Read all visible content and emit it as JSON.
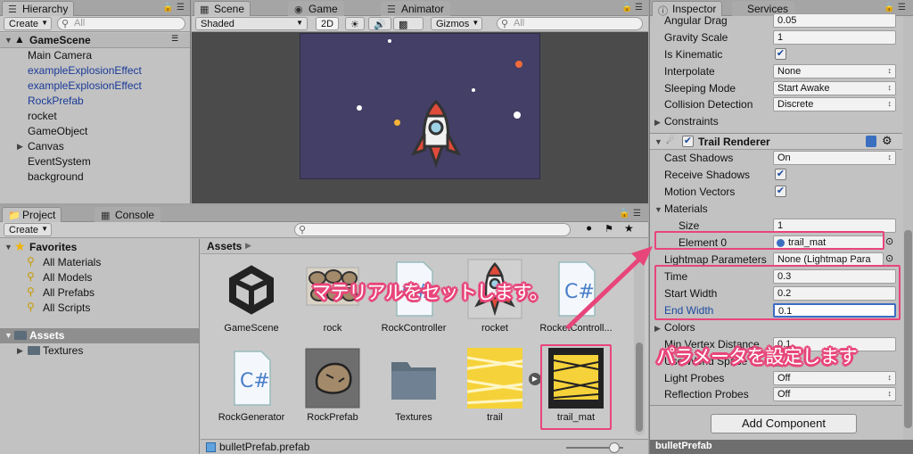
{
  "hierarchy": {
    "tab": "Hierarchy",
    "create_label": "Create",
    "search_placeholder": "All",
    "scene_name": "GameScene",
    "items": [
      {
        "label": "Main Camera",
        "prefab": false
      },
      {
        "label": "exampleExplosionEffect",
        "prefab": true
      },
      {
        "label": "exampleExplosionEffect",
        "prefab": true
      },
      {
        "label": "RockPrefab",
        "prefab": true
      },
      {
        "label": "rocket",
        "prefab": false
      },
      {
        "label": "GameObject",
        "prefab": false
      },
      {
        "label": "Canvas",
        "prefab": false
      },
      {
        "label": "EventSystem",
        "prefab": false
      },
      {
        "label": "background",
        "prefab": false
      }
    ]
  },
  "scene": {
    "tabs": [
      "Scene",
      "Game",
      "Animator"
    ],
    "shading_mode": "Shaded",
    "mode_2d": "2D",
    "gizmos_label": "Gizmos",
    "search_placeholder": "All",
    "background_color": "#433f66"
  },
  "project": {
    "tabs": [
      "Project",
      "Console"
    ],
    "create_label": "Create",
    "favorites_label": "Favorites",
    "favorites": [
      "All Materials",
      "All Models",
      "All Prefabs",
      "All Scripts"
    ],
    "assets_root": "Assets",
    "subfolders": [
      "Textures"
    ],
    "breadcrumb": "Assets",
    "assets_row1": [
      "GameScene",
      "rock",
      "RockController",
      "rocket",
      "RocketControll..."
    ],
    "assets_row2": [
      "RockGenerator",
      "RockPrefab",
      "Textures",
      "trail",
      "trail_mat"
    ],
    "selected_file": "bulletPrefab.prefab"
  },
  "inspector": {
    "tabs": [
      "Inspector",
      "Services"
    ],
    "rows": {
      "angular_drag": {
        "label": "Angular Drag",
        "value": "0.05"
      },
      "gravity_scale": {
        "label": "Gravity Scale",
        "value": "1"
      },
      "is_kinematic": {
        "label": "Is Kinematic"
      },
      "interpolate": {
        "label": "Interpolate",
        "value": "None"
      },
      "sleeping_mode": {
        "label": "Sleeping Mode",
        "value": "Start Awake"
      },
      "collision_detection": {
        "label": "Collision Detection",
        "value": "Discrete"
      },
      "constraints": {
        "label": "Constraints"
      }
    },
    "trail_renderer": {
      "title": "Trail Renderer",
      "cast_shadows": {
        "label": "Cast Shadows",
        "value": "On"
      },
      "receive_shadows": {
        "label": "Receive Shadows"
      },
      "motion_vectors": {
        "label": "Motion Vectors"
      },
      "materials": {
        "label": "Materials"
      },
      "size": {
        "label": "Size",
        "value": "1"
      },
      "element0": {
        "label": "Element 0",
        "value": "trail_mat"
      },
      "lightmap": {
        "label": "Lightmap Parameters",
        "value": "None (Lightmap Para"
      },
      "time": {
        "label": "Time",
        "value": "0.3"
      },
      "start_width": {
        "label": "Start Width",
        "value": "0.2"
      },
      "end_width": {
        "label": "End Width",
        "value": "0.1"
      },
      "colors": {
        "label": "Colors"
      },
      "min_vertex": {
        "label": "Min Vertex Distance",
        "value": "0.1"
      },
      "use_world_space": {
        "label": "Use World Space"
      },
      "light_probes": {
        "label": "Light Probes",
        "value": "Off"
      },
      "reflection_probes": {
        "label": "Reflection Probes",
        "value": "Off"
      }
    },
    "add_component": "Add Component",
    "footer": "bulletPrefab"
  },
  "annotations": {
    "material": "マテリアルをセットします。",
    "params": "パラメータを設定します"
  },
  "colors": {
    "accent": "#e8457a",
    "prefab_text": "#1a3a98",
    "selection": "#3d6bc5"
  }
}
